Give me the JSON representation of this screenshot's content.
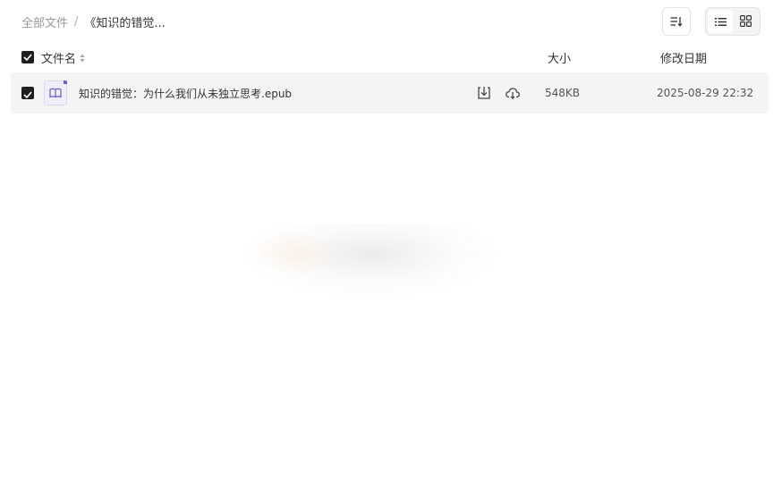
{
  "breadcrumb": {
    "root": "全部文件",
    "separator": "/",
    "current": "《知识的错觉..."
  },
  "toolbar": {
    "sort_icon": "sort-lines-icon",
    "view_modes": [
      {
        "name": "list-view-icon",
        "active": true
      },
      {
        "name": "grid-view-icon",
        "active": false
      }
    ]
  },
  "table": {
    "headers": {
      "name": "文件名",
      "size": "大小",
      "date": "修改日期"
    },
    "rows": [
      {
        "checked": true,
        "icon": "epub-book-icon",
        "name": "知识的错觉：为什么我们从未独立思考.epub",
        "size": "548KB",
        "modified": "2025-08-29 22:32"
      }
    ]
  },
  "colors": {
    "row_bg": "#f4f4f4",
    "checkbox": "#1f1f1f",
    "epub_accent": "#6b5ad1"
  }
}
